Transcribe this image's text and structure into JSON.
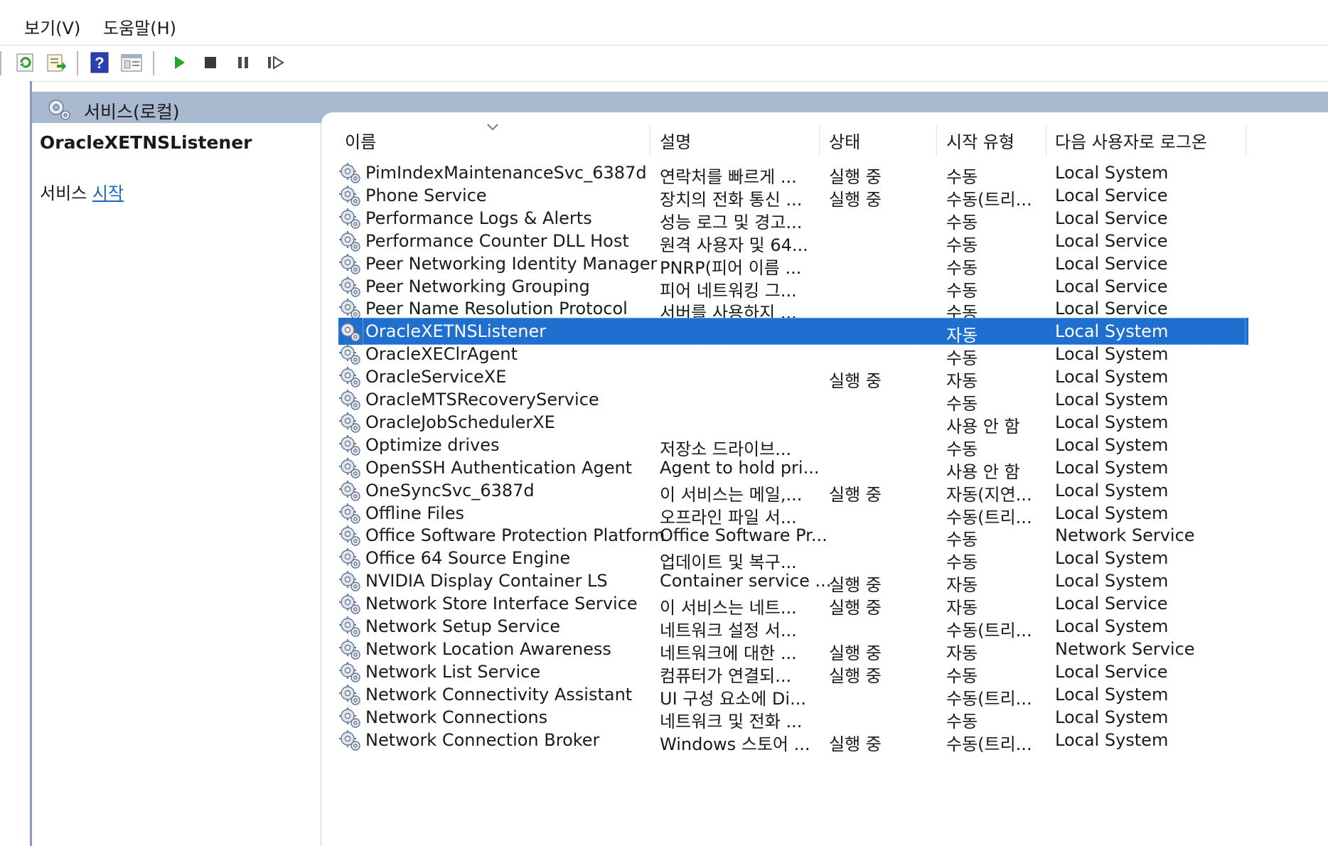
{
  "menu": {
    "view": "보기(V)",
    "help": "도움말(H)"
  },
  "toolbar_icons": [
    "refresh-icon",
    "export-list-icon",
    "help-icon",
    "console-view-icon",
    "play-icon",
    "stop-icon",
    "pause-icon",
    "resume-icon"
  ],
  "band": {
    "title": "서비스(로컬)"
  },
  "left_panel": {
    "title": "OracleXETNSListener",
    "action_prefix": "서비스",
    "action_link": "시작"
  },
  "columns": [
    "이름",
    "설명",
    "상태",
    "시작 유형",
    "다음 사용자로 로그온"
  ],
  "services": [
    {
      "name": "PimIndexMaintenanceSvc_6387d",
      "desc": "연락처를 빠르게 ...",
      "status": "실행 중",
      "start": "수동",
      "logon": "Local System"
    },
    {
      "name": "Phone Service",
      "desc": "장치의 전화 통신 ...",
      "status": "실행 중",
      "start": "수동(트리...",
      "logon": "Local Service"
    },
    {
      "name": "Performance Logs & Alerts",
      "desc": "성능 로그 및 경고...",
      "status": "",
      "start": "수동",
      "logon": "Local Service"
    },
    {
      "name": "Performance Counter DLL Host",
      "desc": "원격 사용자 및 64...",
      "status": "",
      "start": "수동",
      "logon": "Local Service"
    },
    {
      "name": "Peer Networking Identity Manager",
      "desc": "PNRP(피어 이름 ...",
      "status": "",
      "start": "수동",
      "logon": "Local Service"
    },
    {
      "name": "Peer Networking Grouping",
      "desc": "피어 네트워킹 그...",
      "status": "",
      "start": "수동",
      "logon": "Local Service"
    },
    {
      "name": "Peer Name Resolution Protocol",
      "desc": "서버를 사용하지 ...",
      "status": "",
      "start": "수동",
      "logon": "Local Service"
    },
    {
      "name": "OracleXETNSListener",
      "desc": "",
      "status": "",
      "start": "자동",
      "logon": "Local System",
      "selected": true
    },
    {
      "name": "OracleXEClrAgent",
      "desc": "",
      "status": "",
      "start": "수동",
      "logon": "Local System"
    },
    {
      "name": "OracleServiceXE",
      "desc": "",
      "status": "실행 중",
      "start": "자동",
      "logon": "Local System"
    },
    {
      "name": "OracleMTSRecoveryService",
      "desc": "",
      "status": "",
      "start": "수동",
      "logon": "Local System"
    },
    {
      "name": "OracleJobSchedulerXE",
      "desc": "",
      "status": "",
      "start": "사용 안 함",
      "logon": "Local System"
    },
    {
      "name": "Optimize drives",
      "desc": "저장소 드라이브...",
      "status": "",
      "start": "수동",
      "logon": "Local System"
    },
    {
      "name": "OpenSSH Authentication Agent",
      "desc": "Agent to hold pri...",
      "status": "",
      "start": "사용 안 함",
      "logon": "Local System"
    },
    {
      "name": "OneSyncSvc_6387d",
      "desc": "이 서비스는 메일,...",
      "status": "실행 중",
      "start": "자동(지연...",
      "logon": "Local System"
    },
    {
      "name": "Offline Files",
      "desc": "오프라인 파일 서...",
      "status": "",
      "start": "수동(트리...",
      "logon": "Local System"
    },
    {
      "name": "Office Software Protection Platform",
      "desc": "Office Software Pr...",
      "status": "",
      "start": "수동",
      "logon": "Network Service"
    },
    {
      "name": "Office 64 Source Engine",
      "desc": "업데이트 및 복구...",
      "status": "",
      "start": "수동",
      "logon": "Local System"
    },
    {
      "name": "NVIDIA Display Container LS",
      "desc": "Container service ...",
      "status": "실행 중",
      "start": "자동",
      "logon": "Local System"
    },
    {
      "name": "Network Store Interface Service",
      "desc": "이 서비스는 네트...",
      "status": "실행 중",
      "start": "자동",
      "logon": "Local Service"
    },
    {
      "name": "Network Setup Service",
      "desc": "네트워크 설정 서...",
      "status": "",
      "start": "수동(트리...",
      "logon": "Local System"
    },
    {
      "name": "Network Location Awareness",
      "desc": "네트워크에 대한 ...",
      "status": "실행 중",
      "start": "자동",
      "logon": "Network Service"
    },
    {
      "name": "Network List Service",
      "desc": "컴퓨터가 연결되...",
      "status": "실행 중",
      "start": "수동",
      "logon": "Local Service"
    },
    {
      "name": "Network Connectivity Assistant",
      "desc": "UI 구성 요소에 Di...",
      "status": "",
      "start": "수동(트리...",
      "logon": "Local System"
    },
    {
      "name": "Network Connections",
      "desc": "네트워크 및 전화 ...",
      "status": "",
      "start": "수동",
      "logon": "Local System"
    },
    {
      "name": "Network Connection Broker",
      "desc": "Windows 스토어 ...",
      "status": "실행 중",
      "start": "수동(트리...",
      "logon": "Local System"
    }
  ]
}
